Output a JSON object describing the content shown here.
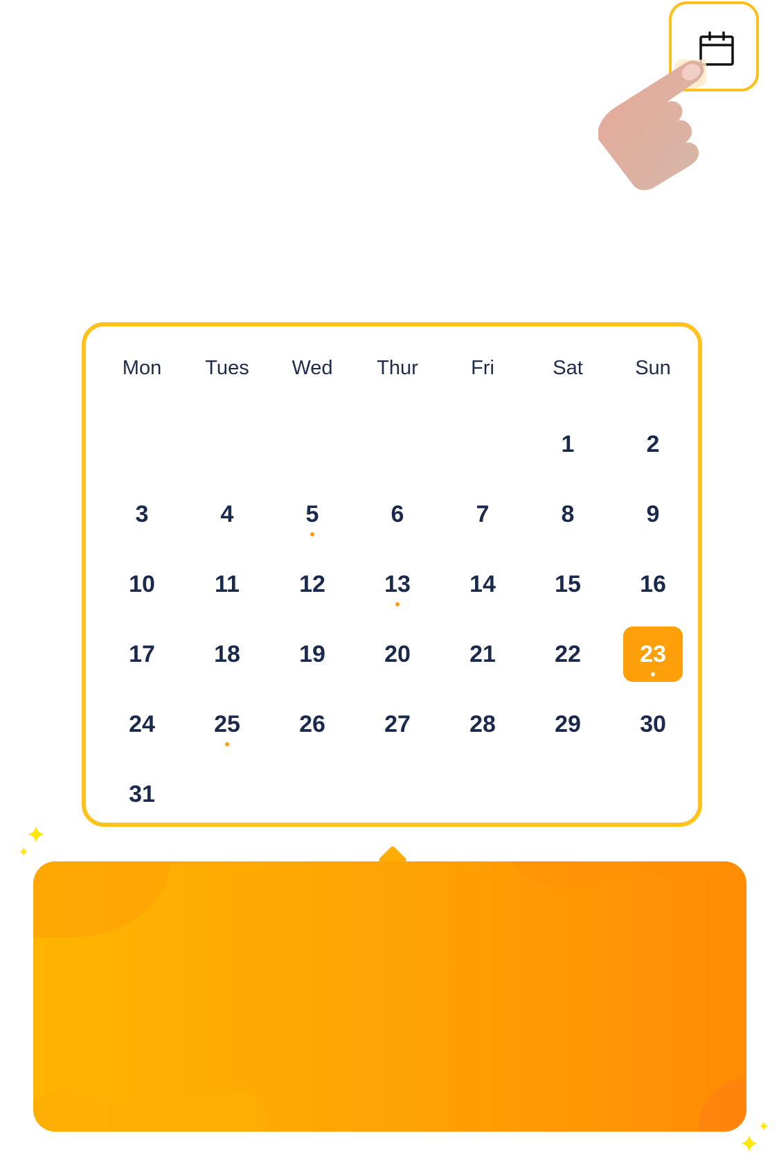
{
  "calendar_button": {
    "icon": "calendar-icon"
  },
  "hand": {
    "icon": "pointing-hand-icon"
  },
  "calendar": {
    "weekdays": [
      "Mon",
      "Tues",
      "Wed",
      "Thur",
      "Fri",
      "Sat",
      "Sun"
    ],
    "first_day_weekday_index": 5,
    "days_in_month": 31,
    "selected_day": 23,
    "event_days": [
      5,
      13,
      23,
      25
    ]
  },
  "colors": {
    "accent": "#ff9f0a",
    "border": "#ffc21c",
    "text": "#1b2a4c",
    "panel_start": "#ffb400",
    "panel_end": "#ff8c05",
    "sparkle": "#ffe60a"
  }
}
